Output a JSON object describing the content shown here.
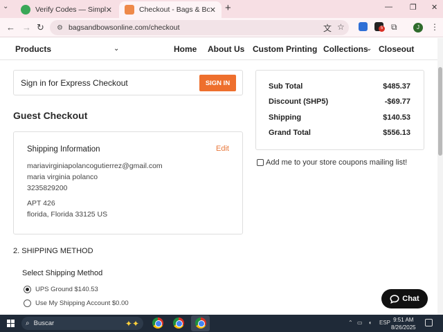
{
  "browser": {
    "tabs": [
      {
        "title": "Verify Codes — SimplyCodes",
        "close": "✕"
      },
      {
        "title": "Checkout - Bags & Bows by S.",
        "close": "✕"
      }
    ],
    "new_tab": "+",
    "url": "bagsandbowsonline.com/checkout",
    "avatar_letter": "J",
    "extension_badge": "5"
  },
  "site_nav": {
    "items": [
      "Products",
      "Home",
      "About Us",
      "Custom Printing",
      "Collections",
      "Closeout"
    ]
  },
  "checkout": {
    "signin_label": "Sign in for Express Checkout",
    "signin_button": "SIGN IN",
    "guest_heading": "Guest Checkout",
    "shipping_info": {
      "heading": "Shipping Information",
      "edit": "Edit",
      "email": "mariavirginiapolancogutierrez@gmail.com",
      "name": "maria virginia polanco",
      "phone": "3235829200",
      "address1": "APT 426",
      "address2": "florida, Florida 33125 US"
    },
    "shipping_method_heading": "2. SHIPPING METHOD",
    "select_label": "Select Shipping Method",
    "options": [
      {
        "label": "UPS Ground $140.53",
        "selected": true
      },
      {
        "label": "Use My Shipping Account $0.00",
        "selected": false
      }
    ]
  },
  "summary": {
    "rows": [
      {
        "label": "Sub Total",
        "value": "$485.37"
      },
      {
        "label": "Discount (SHP5)",
        "value": "-$69.77"
      },
      {
        "label": "Shipping",
        "value": "$140.53"
      },
      {
        "label": "Grand Total",
        "value": "$556.13"
      }
    ],
    "coupon_label": "Add me to your store coupons mailing list!"
  },
  "chat_label": "Chat",
  "taskbar": {
    "search_placeholder": "Buscar",
    "language": "ESP",
    "time": "9:51 AM",
    "date": "8/26/2025"
  },
  "colors": {
    "accent": "#ee6f2d",
    "edit_link": "#e8783c",
    "tab_bg": "#f7dfe4"
  }
}
